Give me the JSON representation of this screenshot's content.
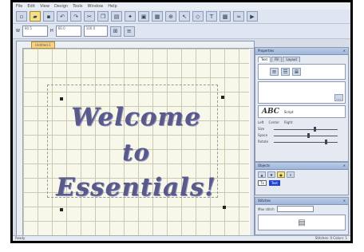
{
  "menu": [
    "File",
    "Edit",
    "View",
    "Design",
    "Tools",
    "Window",
    "Help"
  ],
  "toolbar_icons": [
    "new-icon",
    "open-icon",
    "save-icon",
    "undo-icon",
    "redo-icon",
    "cut-icon",
    "copy-icon",
    "paste-icon",
    "wizard-icon",
    "hoop-icon",
    "grid-icon",
    "zoom-icon",
    "select-icon",
    "node-icon",
    "text-icon",
    "fill-icon",
    "stitch-icon",
    "play-icon"
  ],
  "toolbar2": {
    "width_label": "W",
    "width_value": "80.5",
    "height_label": "H",
    "height_value": "60.0",
    "size_value": "100.0"
  },
  "canvas": {
    "tab_label": "Untitled-1",
    "lines": [
      "Welcome",
      "to",
      "Essentials!"
    ]
  },
  "panel_props": {
    "title": "Properties",
    "tabs": [
      "Text",
      "Fill",
      "Layout"
    ],
    "font_sample": "ABC",
    "font_name": "Script",
    "options": [
      "Left",
      "Center",
      "Right"
    ],
    "slider_labels": [
      "Size",
      "Space",
      "Rotate"
    ]
  },
  "panel_objects": {
    "title": "Objects",
    "selected_item": "Text",
    "item_label": "Tx"
  },
  "panel_stitch": {
    "title": "Stitches",
    "field_label": "Max stitch"
  },
  "status": {
    "left": "Ready",
    "right": "Stitches: 0   Colors: 1"
  }
}
